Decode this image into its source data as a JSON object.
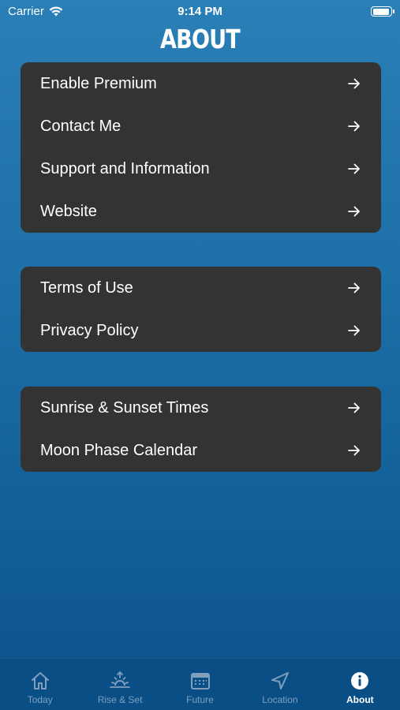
{
  "status": {
    "carrier": "Carrier",
    "time": "9:14 PM"
  },
  "title": "ABOUT",
  "groups": [
    {
      "items": [
        {
          "label": "Enable Premium"
        },
        {
          "label": "Contact Me"
        },
        {
          "label": "Support and Information"
        },
        {
          "label": "Website"
        }
      ]
    },
    {
      "items": [
        {
          "label": "Terms of Use"
        },
        {
          "label": "Privacy Policy"
        }
      ]
    },
    {
      "items": [
        {
          "label": "Sunrise & Sunset Times"
        },
        {
          "label": "Moon Phase Calendar"
        }
      ]
    }
  ],
  "tabs": [
    {
      "label": "Today",
      "icon": "house-icon"
    },
    {
      "label": "Rise & Set",
      "icon": "sunrise-icon"
    },
    {
      "label": "Future",
      "icon": "calendar-icon"
    },
    {
      "label": "Location",
      "icon": "location-arrow-icon"
    },
    {
      "label": "About",
      "icon": "info-icon",
      "active": true
    }
  ],
  "colors": {
    "card": "#333333",
    "tab_bar": "#0a4e86",
    "inactive_tab": "#7f9fbd"
  }
}
